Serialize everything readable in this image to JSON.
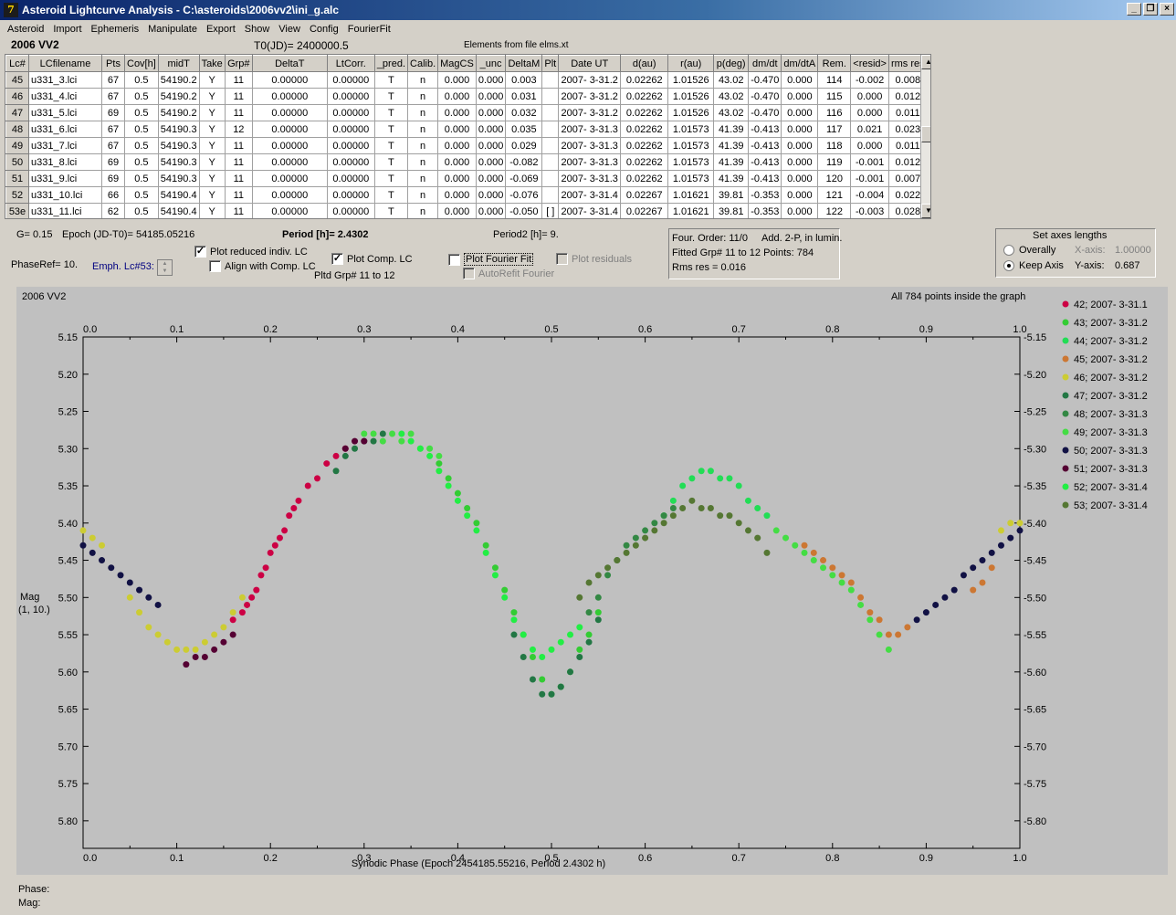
{
  "window": {
    "title": "Asteroid Lightcurve Analysis - C:\\asteroids\\2006vv2\\ini_g.alc",
    "icon_glyph": "7"
  },
  "menu": [
    "Asteroid",
    "Import",
    "Ephemeris",
    "Manipulate",
    "Export",
    "Show",
    "View",
    "Config",
    "FourierFit"
  ],
  "header": {
    "object": "2006 VV2",
    "t0": "T0(JD)= 2400000.5",
    "elements": "Elements from file elms.xt"
  },
  "table": {
    "columns": [
      "Lc#",
      "LCfilename",
      "Pts",
      "Cov[h]",
      "midT",
      "Take",
      "Grp#",
      "DeltaT",
      "LtCorr.",
      "_pred.",
      "Calib.",
      "MagCS",
      "_unc",
      "DeltaM",
      "Plt",
      "Date UT",
      "d(au)",
      "r(au)",
      "p(deg)",
      "dm/dt",
      "dm/dtA",
      "Rem.",
      "<resid>",
      "rms res"
    ],
    "rows": [
      [
        "45",
        "u331_3.lci",
        "67",
        "0.5",
        "54190.2",
        "Y",
        "11",
        "0.00000",
        "0.00000",
        "T",
        "n",
        "0.000",
        "0.000",
        "0.003",
        "",
        "2007- 3-31.2",
        "0.02262",
        "1.01526",
        "43.02",
        "-0.470",
        "0.000",
        "114",
        "-0.002",
        "0.008"
      ],
      [
        "46",
        "u331_4.lci",
        "67",
        "0.5",
        "54190.2",
        "Y",
        "11",
        "0.00000",
        "0.00000",
        "T",
        "n",
        "0.000",
        "0.000",
        "0.031",
        "",
        "2007- 3-31.2",
        "0.02262",
        "1.01526",
        "43.02",
        "-0.470",
        "0.000",
        "115",
        "0.000",
        "0.012"
      ],
      [
        "47",
        "u331_5.lci",
        "69",
        "0.5",
        "54190.2",
        "Y",
        "11",
        "0.00000",
        "0.00000",
        "T",
        "n",
        "0.000",
        "0.000",
        "0.032",
        "",
        "2007- 3-31.2",
        "0.02262",
        "1.01526",
        "43.02",
        "-0.470",
        "0.000",
        "116",
        "0.000",
        "0.011"
      ],
      [
        "48",
        "u331_6.lci",
        "67",
        "0.5",
        "54190.3",
        "Y",
        "12",
        "0.00000",
        "0.00000",
        "T",
        "n",
        "0.000",
        "0.000",
        "0.035",
        "",
        "2007- 3-31.3",
        "0.02262",
        "1.01573",
        "41.39",
        "-0.413",
        "0.000",
        "117",
        "0.021",
        "0.023"
      ],
      [
        "49",
        "u331_7.lci",
        "67",
        "0.5",
        "54190.3",
        "Y",
        "11",
        "0.00000",
        "0.00000",
        "T",
        "n",
        "0.000",
        "0.000",
        "0.029",
        "",
        "2007- 3-31.3",
        "0.02262",
        "1.01573",
        "41.39",
        "-0.413",
        "0.000",
        "118",
        "0.000",
        "0.011"
      ],
      [
        "50",
        "u331_8.lci",
        "69",
        "0.5",
        "54190.3",
        "Y",
        "11",
        "0.00000",
        "0.00000",
        "T",
        "n",
        "0.000",
        "0.000",
        "-0.082",
        "",
        "2007- 3-31.3",
        "0.02262",
        "1.01573",
        "41.39",
        "-0.413",
        "0.000",
        "119",
        "-0.001",
        "0.012"
      ],
      [
        "51",
        "u331_9.lci",
        "69",
        "0.5",
        "54190.3",
        "Y",
        "11",
        "0.00000",
        "0.00000",
        "T",
        "n",
        "0.000",
        "0.000",
        "-0.069",
        "",
        "2007- 3-31.3",
        "0.02262",
        "1.01573",
        "41.39",
        "-0.413",
        "0.000",
        "120",
        "-0.001",
        "0.007"
      ],
      [
        "52",
        "u331_10.lci",
        "66",
        "0.5",
        "54190.4",
        "Y",
        "11",
        "0.00000",
        "0.00000",
        "T",
        "n",
        "0.000",
        "0.000",
        "-0.076",
        "",
        "2007- 3-31.4",
        "0.02267",
        "1.01621",
        "39.81",
        "-0.353",
        "0.000",
        "121",
        "-0.004",
        "0.022"
      ],
      [
        "53e",
        "u331_11.lci",
        "62",
        "0.5",
        "54190.4",
        "Y",
        "11",
        "0.00000",
        "0.00000",
        "T",
        "n",
        "0.000",
        "0.000",
        "-0.050",
        "[ ]",
        "2007- 3-31.4",
        "0.02267",
        "1.01621",
        "39.81",
        "-0.353",
        "0.000",
        "122",
        "-0.003",
        "0.028"
      ]
    ]
  },
  "controls": {
    "g": "G= 0.15",
    "epoch": "Epoch (JD-T0)= 54185.05216",
    "period": "Period [h]= 2.4302",
    "period2": "Period2 [h]= 9.",
    "phase_ref": "PhaseRef= 10.",
    "emph": "Emph. Lc#53:",
    "plot_reduced": "Plot reduced indiv. LC",
    "align": "Align with Comp. LC",
    "plot_comp": "Plot Comp. LC",
    "pltd_grp": "Pltd Grp#  11 to   12",
    "plot_fourier": "Plot Fourier Fit",
    "autorefit": "AutoRefit Fourier",
    "plot_residuals": "Plot residuals",
    "four_order": "Four. Order: 11/0",
    "add_2p": "Add. 2-P, in lumin.",
    "fitted": "Fitted Grp# 11 to 12 Points: 784",
    "rms": "Rms res      = 0.016",
    "axes_title": "Set axes lengths",
    "overally": "Overally",
    "keep_axis": "Keep Axis",
    "x_axis_label": "X-axis:",
    "x_axis_value": "1.00000",
    "y_axis_label": "Y-axis:",
    "y_axis_value": "0.687"
  },
  "chart_data": {
    "type": "scatter",
    "title": "2006 VV2",
    "note": "All 784 points inside the graph",
    "xlabel": "Synodic Phase (Epoch 2454185.55216, Period 2.4302 h)",
    "ylabel": "Mag",
    "ylabel2": "(1, 10.)",
    "xlim": [
      0.0,
      1.0
    ],
    "ylim": [
      5.15,
      5.837
    ],
    "y_inverted": true,
    "x_ticks": [
      "0.0",
      "0.1",
      "0.2",
      "0.3",
      "0.4",
      "0.5",
      "0.6",
      "0.7",
      "0.8",
      "0.9",
      "1.0"
    ],
    "y_ticks": [
      "5.15",
      "5.20",
      "5.25",
      "5.30",
      "5.35",
      "5.40",
      "5.45",
      "5.50",
      "5.55",
      "5.60",
      "5.65",
      "5.70",
      "5.75",
      "5.80"
    ],
    "legend_position": "right",
    "series": [
      {
        "name": "42; 2007- 3-31.1",
        "color": "#cc0044",
        "x": [
          0.16,
          0.17,
          0.175,
          0.18,
          0.185,
          0.19,
          0.195,
          0.2,
          0.205,
          0.21,
          0.215,
          0.22,
          0.225,
          0.23,
          0.24,
          0.25,
          0.26,
          0.27,
          0.28
        ],
        "y": [
          5.53,
          5.52,
          5.51,
          5.5,
          5.49,
          5.47,
          5.46,
          5.44,
          5.43,
          5.42,
          5.41,
          5.39,
          5.38,
          5.37,
          5.35,
          5.34,
          5.32,
          5.31,
          5.3
        ]
      },
      {
        "name": "43; 2007- 3-31.2",
        "color": "#33cc33",
        "x": [
          0.38,
          0.39,
          0.4,
          0.41,
          0.42,
          0.43,
          0.44,
          0.45,
          0.46,
          0.47,
          0.48,
          0.49,
          0.5,
          0.51,
          0.52,
          0.53,
          0.54,
          0.55
        ],
        "y": [
          5.32,
          5.34,
          5.36,
          5.38,
          5.4,
          5.43,
          5.46,
          5.49,
          5.52,
          5.55,
          5.58,
          5.61,
          5.63,
          5.62,
          5.6,
          5.57,
          5.55,
          5.52
        ]
      },
      {
        "name": "44; 2007- 3-31.2",
        "color": "#22dd55",
        "x": [
          0.62,
          0.63,
          0.64,
          0.65,
          0.66,
          0.67,
          0.68,
          0.69,
          0.7,
          0.71,
          0.72,
          0.73
        ],
        "y": [
          5.39,
          5.37,
          5.35,
          5.34,
          5.33,
          5.33,
          5.34,
          5.34,
          5.35,
          5.37,
          5.38,
          5.39
        ]
      },
      {
        "name": "45; 2007- 3-31.2",
        "color": "#cc7733",
        "x": [
          0.77,
          0.78,
          0.79,
          0.8,
          0.81,
          0.82,
          0.83,
          0.84,
          0.85,
          0.86,
          0.87,
          0.88,
          0.95,
          0.96,
          0.97
        ],
        "y": [
          5.43,
          5.44,
          5.45,
          5.46,
          5.47,
          5.48,
          5.5,
          5.52,
          5.53,
          5.55,
          5.55,
          5.54,
          5.49,
          5.48,
          5.46
        ]
      },
      {
        "name": "46; 2007- 3-31.2",
        "color": "#cccc33",
        "x": [
          0.0,
          0.01,
          0.02,
          0.05,
          0.06,
          0.07,
          0.08,
          0.09,
          0.1,
          0.11,
          0.12,
          0.13,
          0.14,
          0.15,
          0.16,
          0.17,
          0.98,
          0.99,
          1.0
        ],
        "y": [
          5.41,
          5.42,
          5.43,
          5.5,
          5.52,
          5.54,
          5.55,
          5.56,
          5.57,
          5.57,
          5.57,
          5.56,
          5.55,
          5.54,
          5.52,
          5.5,
          5.41,
          5.4,
          5.4
        ]
      },
      {
        "name": "47; 2007- 3-31.2",
        "color": "#227744",
        "x": [
          0.27,
          0.28,
          0.29,
          0.3,
          0.31,
          0.32,
          0.46,
          0.47,
          0.48,
          0.49,
          0.5,
          0.51,
          0.52,
          0.53,
          0.54,
          0.55
        ],
        "y": [
          5.33,
          5.31,
          5.3,
          5.29,
          5.29,
          5.28,
          5.55,
          5.58,
          5.61,
          5.63,
          5.63,
          5.62,
          5.6,
          5.58,
          5.56,
          5.53
        ]
      },
      {
        "name": "48; 2007- 3-31.3",
        "color": "#338844",
        "x": [
          0.54,
          0.55,
          0.56,
          0.57,
          0.58,
          0.59,
          0.6,
          0.61,
          0.62,
          0.63
        ],
        "y": [
          5.52,
          5.5,
          5.47,
          5.45,
          5.43,
          5.42,
          5.41,
          5.4,
          5.39,
          5.38
        ]
      },
      {
        "name": "49; 2007- 3-31.3",
        "color": "#44dd44",
        "x": [
          0.3,
          0.31,
          0.32,
          0.33,
          0.34,
          0.35,
          0.36,
          0.37,
          0.38,
          0.74,
          0.75,
          0.76,
          0.77,
          0.78,
          0.79,
          0.8,
          0.81,
          0.82,
          0.83,
          0.84,
          0.85,
          0.86
        ],
        "y": [
          5.28,
          5.28,
          5.29,
          5.28,
          5.29,
          5.28,
          5.3,
          5.3,
          5.31,
          5.41,
          5.42,
          5.43,
          5.44,
          5.45,
          5.46,
          5.47,
          5.48,
          5.49,
          5.51,
          5.53,
          5.55,
          5.57
        ]
      },
      {
        "name": "50; 2007- 3-31.3",
        "color": "#111144",
        "x": [
          0.0,
          0.01,
          0.02,
          0.03,
          0.04,
          0.05,
          0.06,
          0.07,
          0.08,
          0.89,
          0.9,
          0.91,
          0.92,
          0.93,
          0.94,
          0.95,
          0.96,
          0.97,
          0.98,
          0.99,
          1.0
        ],
        "y": [
          5.43,
          5.44,
          5.45,
          5.46,
          5.47,
          5.48,
          5.49,
          5.5,
          5.51,
          5.53,
          5.52,
          5.51,
          5.5,
          5.49,
          5.47,
          5.46,
          5.45,
          5.44,
          5.43,
          5.42,
          5.41
        ]
      },
      {
        "name": "51; 2007- 3-31.3",
        "color": "#550033",
        "x": [
          0.11,
          0.12,
          0.13,
          0.14,
          0.15,
          0.16,
          0.28,
          0.29,
          0.3
        ],
        "y": [
          5.59,
          5.58,
          5.58,
          5.57,
          5.56,
          5.55,
          5.3,
          5.29,
          5.29
        ]
      },
      {
        "name": "52; 2007- 3-31.4",
        "color": "#22ee44",
        "x": [
          0.34,
          0.35,
          0.36,
          0.37,
          0.38,
          0.39,
          0.4,
          0.41,
          0.42,
          0.43,
          0.44,
          0.45,
          0.46,
          0.47,
          0.48,
          0.49,
          0.5,
          0.51,
          0.52,
          0.53
        ],
        "y": [
          5.28,
          5.29,
          5.3,
          5.31,
          5.33,
          5.35,
          5.37,
          5.39,
          5.41,
          5.44,
          5.47,
          5.5,
          5.53,
          5.55,
          5.57,
          5.58,
          5.57,
          5.56,
          5.55,
          5.54
        ]
      },
      {
        "name": "53; 2007- 3-31.4",
        "color": "#557733",
        "x": [
          0.53,
          0.54,
          0.55,
          0.56,
          0.57,
          0.58,
          0.59,
          0.6,
          0.61,
          0.62,
          0.63,
          0.64,
          0.65,
          0.66,
          0.67,
          0.68,
          0.69,
          0.7,
          0.71,
          0.72,
          0.73
        ],
        "y": [
          5.5,
          5.48,
          5.47,
          5.46,
          5.45,
          5.44,
          5.43,
          5.42,
          5.41,
          5.4,
          5.39,
          5.38,
          5.37,
          5.38,
          5.38,
          5.39,
          5.39,
          5.4,
          5.41,
          5.42,
          5.44
        ]
      }
    ]
  },
  "footer": {
    "phase": "Phase:",
    "mag": "Mag:"
  },
  "colors": {
    "titlebar": "#0a246a",
    "chrome": "#d4d0c8",
    "plot_bg": "#c0c0c0"
  }
}
